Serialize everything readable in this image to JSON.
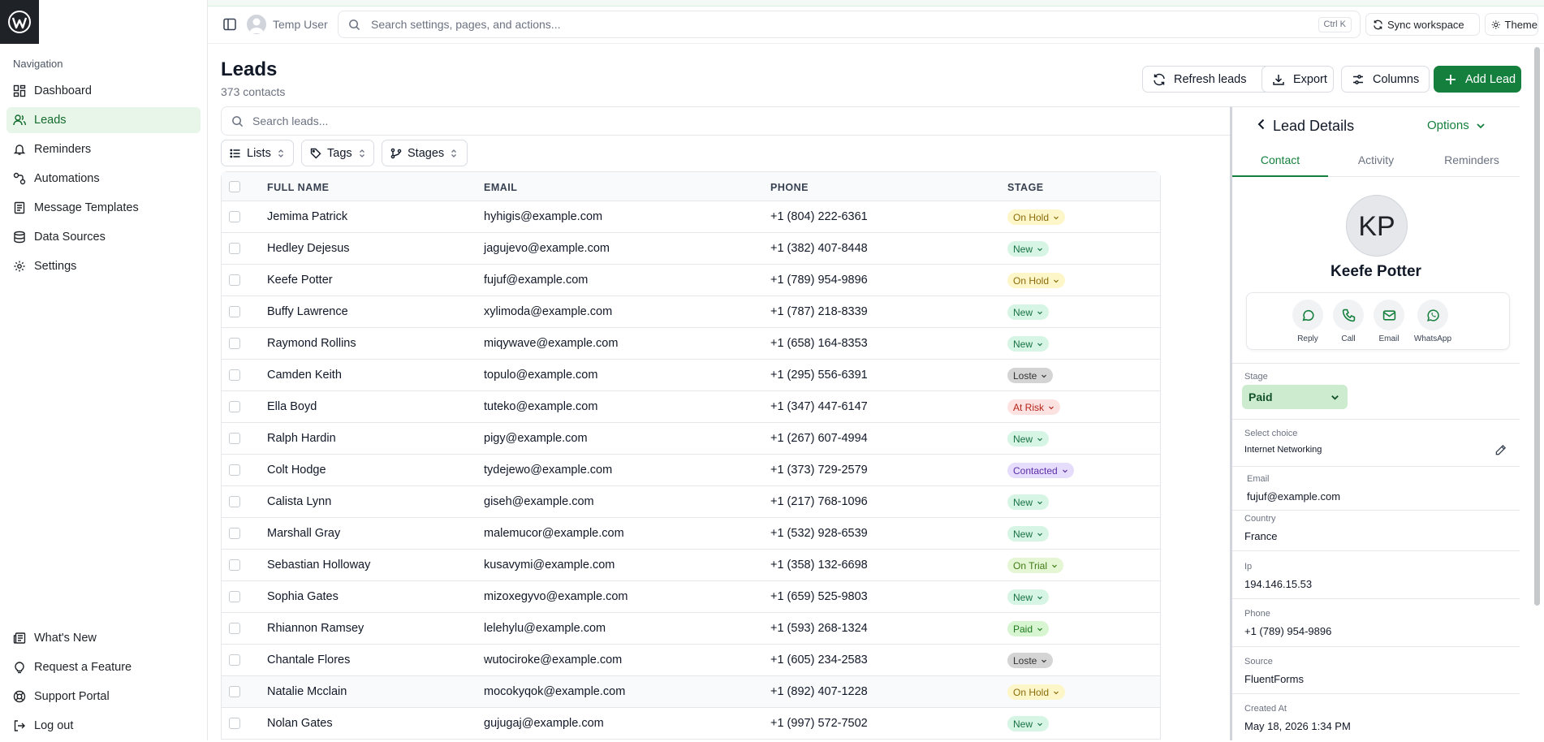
{
  "topbar": {
    "user_name": "Temp User",
    "search_placeholder": "Search settings, pages, and actions...",
    "shortcut": "Ctrl K",
    "sync_label": "Sync workspace",
    "theme_label": "Theme"
  },
  "sidebar": {
    "heading": "Navigation",
    "items": [
      {
        "label": "Dashboard",
        "icon": "dashboard-icon"
      },
      {
        "label": "Leads",
        "icon": "users-icon"
      },
      {
        "label": "Reminders",
        "icon": "bell-icon"
      },
      {
        "label": "Automations",
        "icon": "workflow-icon"
      },
      {
        "label": "Message Templates",
        "icon": "document-icon"
      },
      {
        "label": "Data Sources",
        "icon": "database-icon"
      },
      {
        "label": "Settings",
        "icon": "gear-icon"
      }
    ],
    "bottom_items": [
      {
        "label": "What's New",
        "icon": "newspaper-icon"
      },
      {
        "label": "Request a Feature",
        "icon": "lightbulb-icon"
      },
      {
        "label": "Support Portal",
        "icon": "lifebuoy-icon"
      },
      {
        "label": "Log out",
        "icon": "logout-icon"
      }
    ]
  },
  "page": {
    "title": "Leads",
    "subtitle": "373 contacts",
    "refresh_label": "Refresh leads",
    "export_label": "Export",
    "columns_label": "Columns",
    "add_label": "Add Lead",
    "search_placeholder": "Search leads...",
    "filters": {
      "lists": "Lists",
      "tags": "Tags",
      "stages": "Stages"
    }
  },
  "table": {
    "headers": {
      "name": "FULL NAME",
      "email": "EMAIL",
      "phone": "PHONE",
      "stage": "STAGE"
    },
    "rows": [
      {
        "name": "Jemima Patrick",
        "email": "hyhigis@example.com",
        "phone": "+1 (804) 222-6361",
        "stage": "On Hold"
      },
      {
        "name": "Hedley Dejesus",
        "email": "jagujevo@example.com",
        "phone": "+1 (382) 407-8448",
        "stage": "New"
      },
      {
        "name": "Keefe Potter",
        "email": "fujuf@example.com",
        "phone": "+1 (789) 954-9896",
        "stage": "On Hold"
      },
      {
        "name": "Buffy Lawrence",
        "email": "xylimoda@example.com",
        "phone": "+1 (787) 218-8339",
        "stage": "New"
      },
      {
        "name": "Raymond Rollins",
        "email": "miqywave@example.com",
        "phone": "+1 (658) 164-8353",
        "stage": "New"
      },
      {
        "name": "Camden Keith",
        "email": "topulo@example.com",
        "phone": "+1 (295) 556-6391",
        "stage": "Loste"
      },
      {
        "name": "Ella Boyd",
        "email": "tuteko@example.com",
        "phone": "+1 (347) 447-6147",
        "stage": "At Risk"
      },
      {
        "name": "Ralph Hardin",
        "email": "pigy@example.com",
        "phone": "+1 (267) 607-4994",
        "stage": "New"
      },
      {
        "name": "Colt Hodge",
        "email": "tydejewo@example.com",
        "phone": "+1 (373) 729-2579",
        "stage": "Contacted"
      },
      {
        "name": "Calista Lynn",
        "email": "giseh@example.com",
        "phone": "+1 (217) 768-1096",
        "stage": "New"
      },
      {
        "name": "Marshall Gray",
        "email": "malemucor@example.com",
        "phone": "+1 (532) 928-6539",
        "stage": "New"
      },
      {
        "name": "Sebastian Holloway",
        "email": "kusavymi@example.com",
        "phone": "+1 (358) 132-6698",
        "stage": "On Trial"
      },
      {
        "name": "Sophia Gates",
        "email": "mizoxegyvo@example.com",
        "phone": "+1 (659) 525-9803",
        "stage": "New"
      },
      {
        "name": "Rhiannon Ramsey",
        "email": "lelehylu@example.com",
        "phone": "+1 (593) 268-1324",
        "stage": "Paid"
      },
      {
        "name": "Chantale Flores",
        "email": "wutociroke@example.com",
        "phone": "+1 (605) 234-2583",
        "stage": "Loste"
      },
      {
        "name": "Natalie Mcclain",
        "email": "mocokyqok@example.com",
        "phone": "+1 (892) 407-1228",
        "stage": "On Hold"
      },
      {
        "name": "Nolan Gates",
        "email": "gujugaj@example.com",
        "phone": "+1 (997) 572-7502",
        "stage": "New"
      }
    ]
  },
  "panel": {
    "title": "Lead Details",
    "options_label": "Options",
    "tabs": [
      "Contact",
      "Activity",
      "Reminders"
    ],
    "initials": "KP",
    "name": "Keefe Potter",
    "actions": [
      "Reply",
      "Call",
      "Email",
      "WhatsApp"
    ],
    "stage_label": "Stage",
    "stage_value": "Paid",
    "choice_label": "Select choice",
    "choice_value": "Internet Networking",
    "fields": [
      {
        "label": "Email",
        "value": "fujuf@example.com"
      },
      {
        "label": "Country",
        "value": "France"
      },
      {
        "label": "Ip",
        "value": "194.146.15.53"
      },
      {
        "label": "Phone",
        "value": "+1 (789) 954-9896"
      },
      {
        "label": "Source",
        "value": "FluentForms"
      },
      {
        "label": "Created At",
        "value": "May 18, 2026 1:34 PM"
      }
    ]
  },
  "colors": {
    "accent": "#15803d",
    "active_nav_bg": "#e8f5e9"
  }
}
